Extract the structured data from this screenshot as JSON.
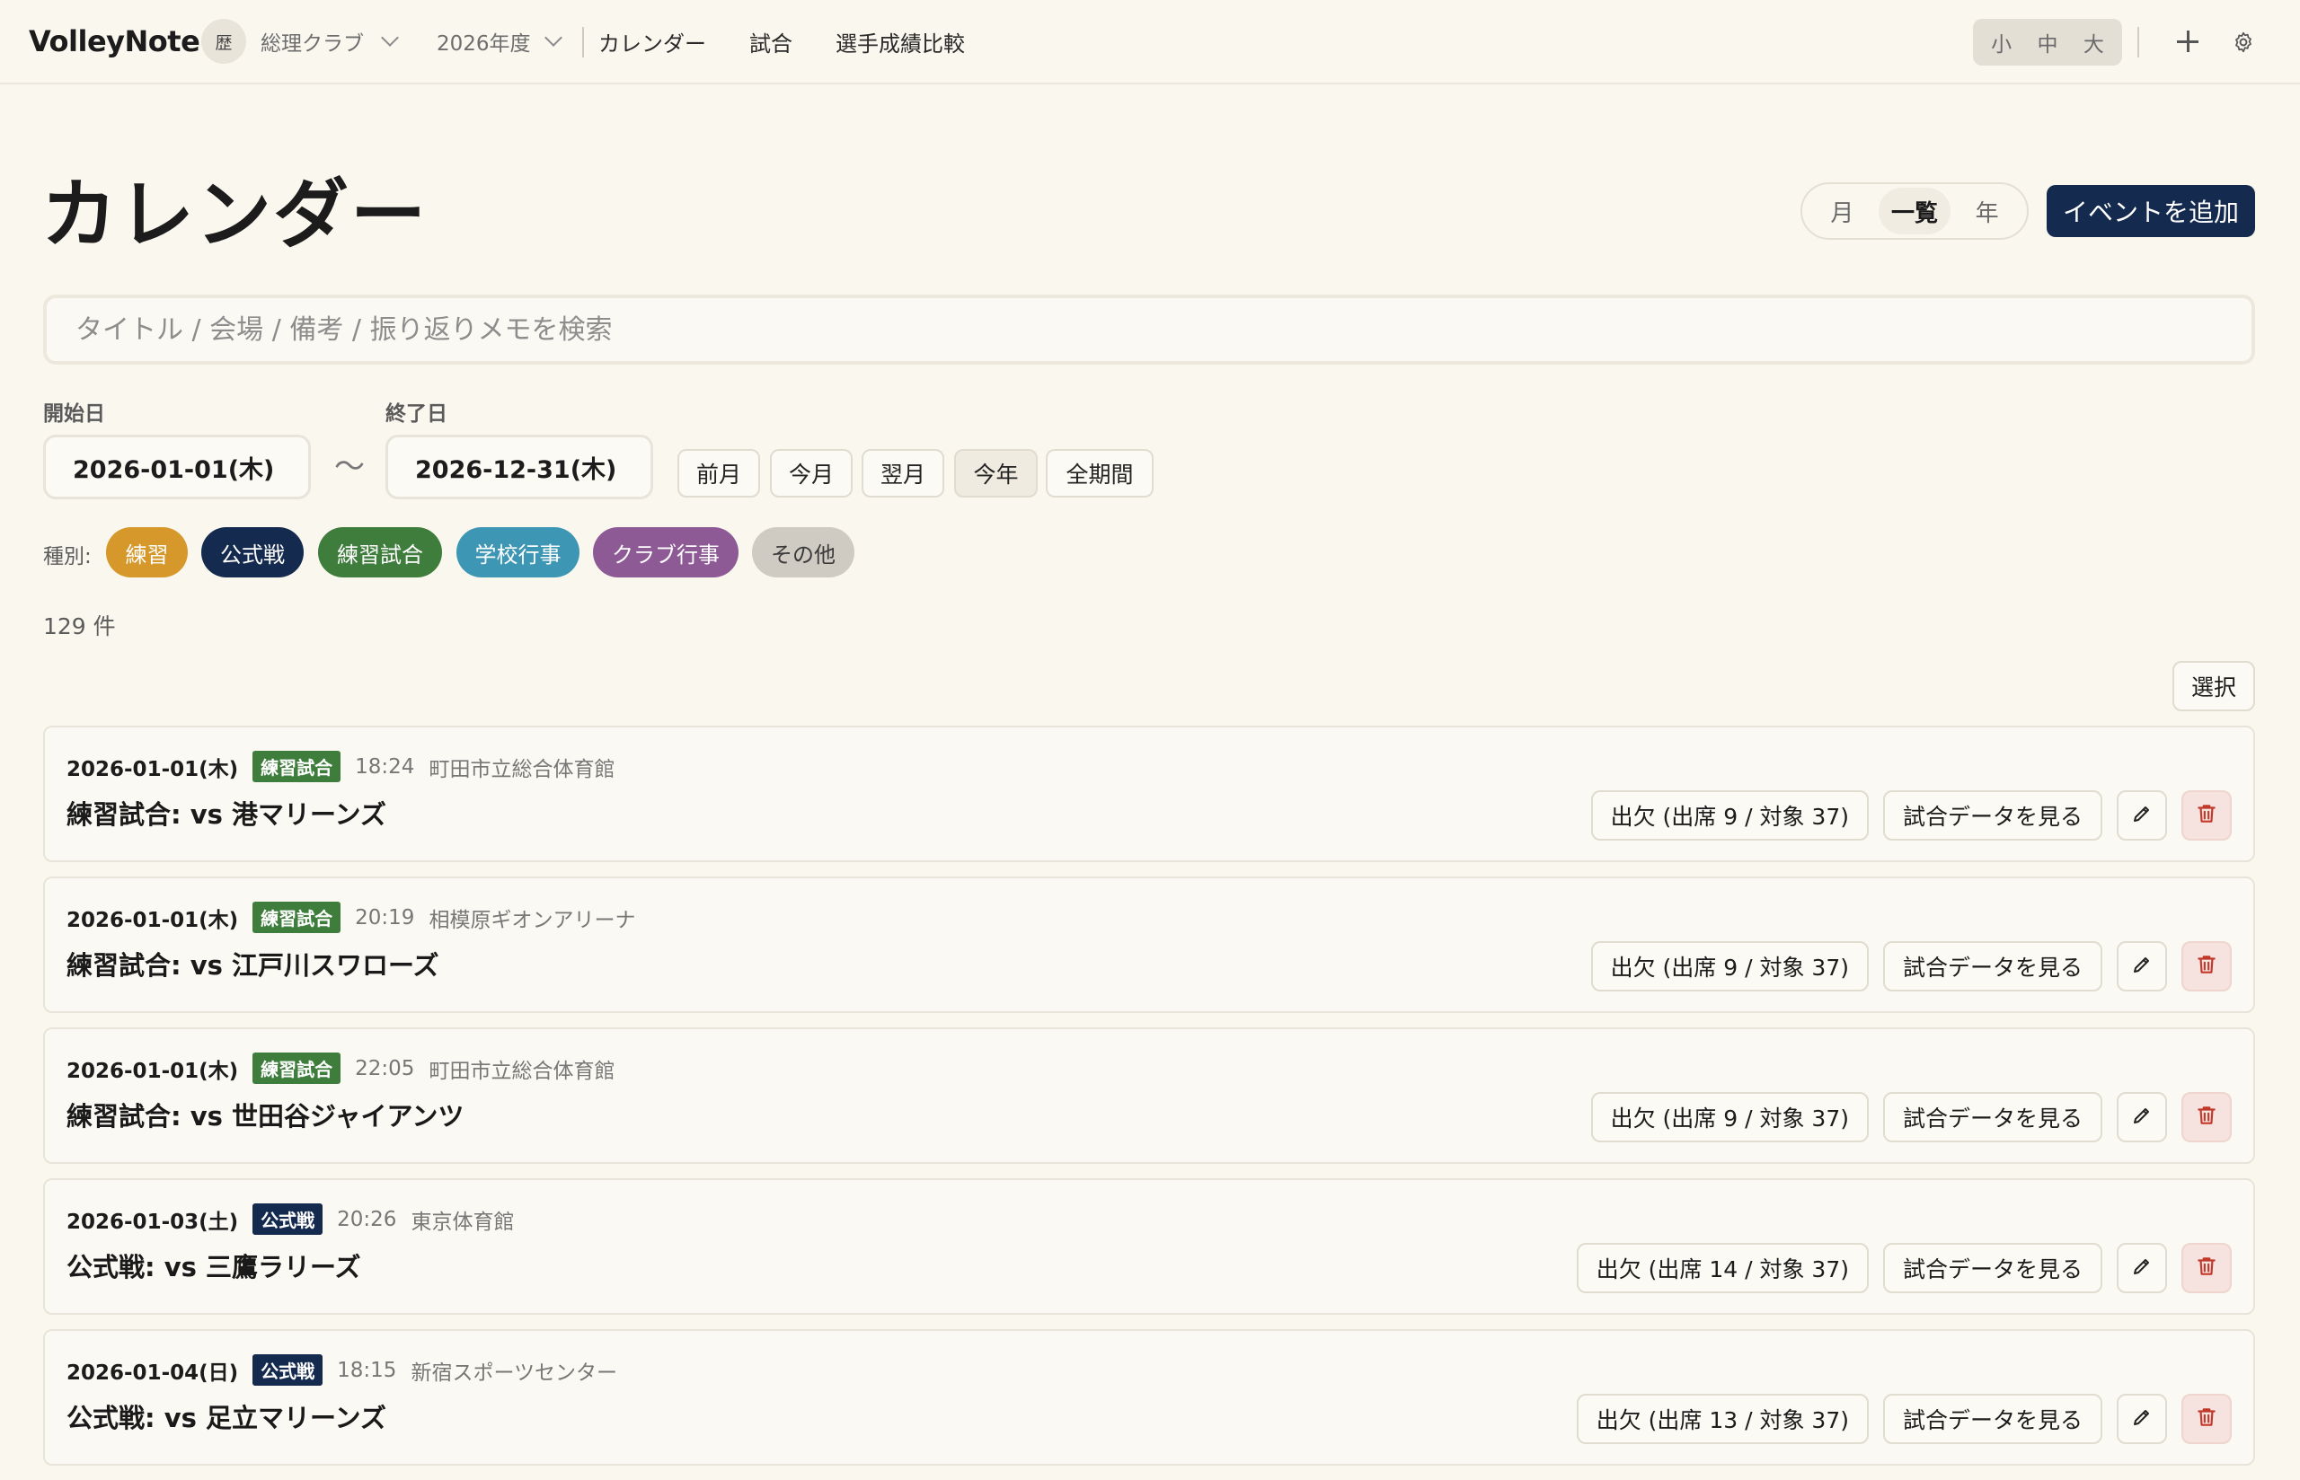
{
  "app": {
    "brand": "VolleyNote"
  },
  "topbar": {
    "club_badge": "歴",
    "club": "総理クラブ",
    "year": "2026年度",
    "nav": [
      "カレンダー",
      "試合",
      "選手成績比較"
    ],
    "font_sizes": [
      "小",
      "中",
      "大"
    ]
  },
  "page": {
    "title": "カレンダー",
    "view_modes": [
      "月",
      "一覧",
      "年"
    ],
    "active_view": "一覧",
    "add_button": "イベントを追加",
    "search_placeholder": "タイトル / 会場 / 備考 / 振り返りメモを検索"
  },
  "filters": {
    "start_label": "開始日",
    "start_value": "2026-01-01(木)",
    "end_label": "終了日",
    "end_value": "2026-12-31(木)",
    "range_sep": "〜",
    "quick": [
      "前月",
      "今月",
      "翌月",
      "今年",
      "全期間"
    ],
    "active_quick": "今年",
    "type_label": "種別:",
    "types": [
      {
        "label": "練習",
        "color": "#d6982a"
      },
      {
        "label": "公式戦",
        "color": "#142a4e"
      },
      {
        "label": "練習試合",
        "color": "#3e7d3c"
      },
      {
        "label": "学校行事",
        "color": "#3d97b4"
      },
      {
        "label": "クラブ行事",
        "color": "#8e5a95"
      },
      {
        "label": "その他",
        "color": "#cfcbc2"
      }
    ]
  },
  "count": "129 件",
  "select_button": "選択",
  "events": [
    {
      "date": "2026-01-01(木)",
      "type": "練習試合",
      "type_color": "#3e7d3c",
      "time": "18:24",
      "venue": "町田市立総合体育館",
      "title": "練習試合: vs 港マリーンズ",
      "attendance": "出欠 (出席 9 / 対象 37)",
      "data_button": "試合データを見る"
    },
    {
      "date": "2026-01-01(木)",
      "type": "練習試合",
      "type_color": "#3e7d3c",
      "time": "20:19",
      "venue": "相模原ギオンアリーナ",
      "title": "練習試合: vs 江戸川スワローズ",
      "attendance": "出欠 (出席 9 / 対象 37)",
      "data_button": "試合データを見る"
    },
    {
      "date": "2026-01-01(木)",
      "type": "練習試合",
      "type_color": "#3e7d3c",
      "time": "22:05",
      "venue": "町田市立総合体育館",
      "title": "練習試合: vs 世田谷ジャイアンツ",
      "attendance": "出欠 (出席 9 / 対象 37)",
      "data_button": "試合データを見る"
    },
    {
      "date": "2026-01-03(土)",
      "type": "公式戦",
      "type_color": "#142a4e",
      "time": "20:26",
      "venue": "東京体育館",
      "title": "公式戦: vs 三鷹ラリーズ",
      "attendance": "出欠 (出席 14 / 対象 37)",
      "data_button": "試合データを見る"
    },
    {
      "date": "2026-01-04(日)",
      "type": "公式戦",
      "type_color": "#142a4e",
      "time": "18:15",
      "venue": "新宿スポーツセンター",
      "title": "公式戦: vs 足立マリーンズ",
      "attendance": "出欠 (出席 13 / 対象 37)",
      "data_button": "試合データを見る"
    }
  ]
}
